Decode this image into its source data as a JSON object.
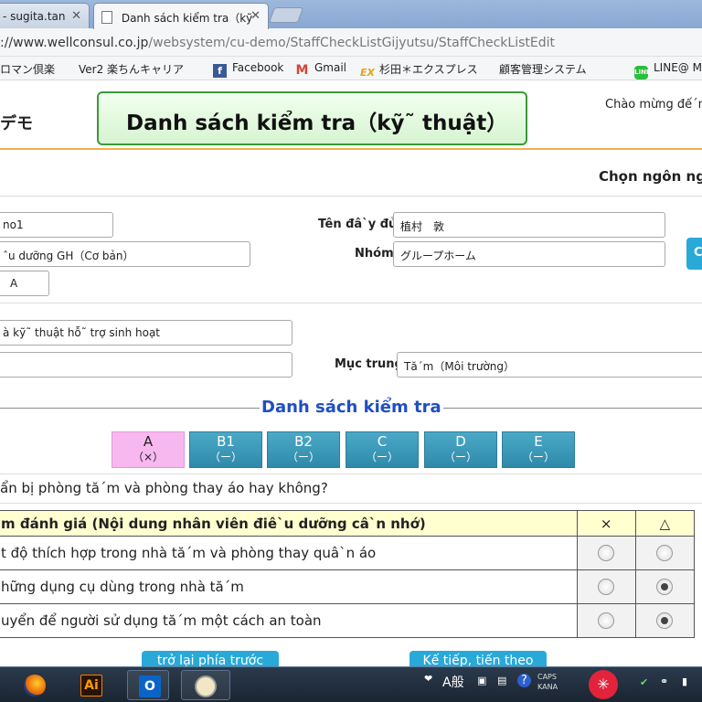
{
  "browser": {
    "tabs": [
      {
        "label": "- sugita.tan"
      },
      {
        "label": "Danh sách kiểm tra（kỹ"
      }
    ],
    "url_host": "://www.wellconsul.co.jp",
    "url_path": "/websystem/cu-demo/StaffCheckListGijyutsu/StaffCheckListEdit",
    "bookmarks": [
      {
        "label": "ロマン倶楽",
        "icon": "folder-icon"
      },
      {
        "label": "Ver2 楽ちんキャリア",
        "icon": "page-icon"
      },
      {
        "label": "Facebook",
        "icon": "facebook-icon"
      },
      {
        "label": "Gmail",
        "icon": "gmail-icon"
      },
      {
        "label": "杉田＊エクスプレス",
        "icon": "ex-icon"
      },
      {
        "label": "顧客管理システム",
        "icon": "page-icon"
      },
      {
        "label": "LINE@ M",
        "icon": "line-icon"
      }
    ]
  },
  "header": {
    "demo_label": "デモ",
    "title": "Danh sách kiểm tra（kỹ˜ thuật）",
    "welcome": "Chào mừng đế´n",
    "language_label": "Chọn ngôn ngữ"
  },
  "form": {
    "staff_no": "no1",
    "full_name_label": "Tên đâ`y đủ",
    "full_name": "植村　敦",
    "course": "ˆu dưỡng GH（Cơ bản）",
    "group_label": "Nhóm",
    "group": "グループホーム",
    "level": "A",
    "category": "à kỹ˜ thuật hỗ˜ trợ sinh hoạt",
    "sub": "",
    "focus_label": "Mục trung",
    "focus": "Tă´m（Môi trường）"
  },
  "checklist": {
    "section_title": "Danh sách kiểm tra",
    "levels": [
      {
        "name": "A",
        "mark": "（×）",
        "active": true
      },
      {
        "name": "B1",
        "mark": "（ー）",
        "active": false
      },
      {
        "name": "B2",
        "mark": "（ー）",
        "active": false
      },
      {
        "name": "C",
        "mark": "（ー）",
        "active": false
      },
      {
        "name": "D",
        "mark": "（ー）",
        "active": false
      },
      {
        "name": "E",
        "mark": "（ー）",
        "active": false
      }
    ],
    "question": "ẩn bị phòng tă´m và phòng thay áo hay không?",
    "table_header": "m đánh giá (Nội dung nhân viên điê`u dưỡng câ`n nhớ)",
    "col_x": "×",
    "col_tri": "△",
    "rows": [
      {
        "text": "t độ thích hợp trong nhà tă´m và phòng thay quâ`n áo",
        "x_on": false,
        "tri_on": false
      },
      {
        "text": "hững dụng cụ dùng trong nhà tă´m",
        "x_on": false,
        "tri_on": true
      },
      {
        "text": "uyển để người sử dụng tă´m một cách an toàn",
        "x_on": false,
        "tri_on": true
      }
    ],
    "back_button": "trở lại phía trước",
    "next_button": "Kế tiếp, tiến theo"
  },
  "taskbar": {
    "ime_a": "A",
    "ime_mode": "般",
    "caps": "CAPS",
    "kana": "KANA"
  }
}
